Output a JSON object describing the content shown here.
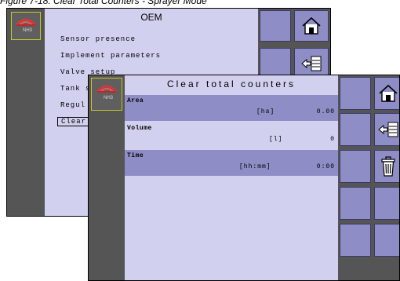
{
  "caption": "Figure 7-18: Clear Total Counters - Sprayer Mode",
  "logo_text": "NH3",
  "oem_screen": {
    "title": "OEM",
    "menu_items": [
      "Sensor presence",
      "Implement parameters",
      "Valve setup",
      "Tank s",
      "Regul",
      "Clear"
    ],
    "icons": [
      "home-icon",
      "back-arrow-icon"
    ]
  },
  "clear_screen": {
    "title": "Clear total counters",
    "rows": [
      {
        "label": "Area",
        "unit": "[ha]",
        "value": "0.00"
      },
      {
        "label": "Volume",
        "unit": "[l]",
        "value": "0"
      },
      {
        "label": "Time",
        "unit": "[hh:mm]",
        "value": "0:00"
      }
    ],
    "icons": [
      "home-icon",
      "back-arrow-icon",
      "trash-can-icon"
    ]
  },
  "colors": {
    "content_bg": "#d1d0ee",
    "row_highlight": "#8e8dc6",
    "button": "#8e8dc6",
    "sidebar": "#555555",
    "logo_border": "#c7c72a"
  }
}
